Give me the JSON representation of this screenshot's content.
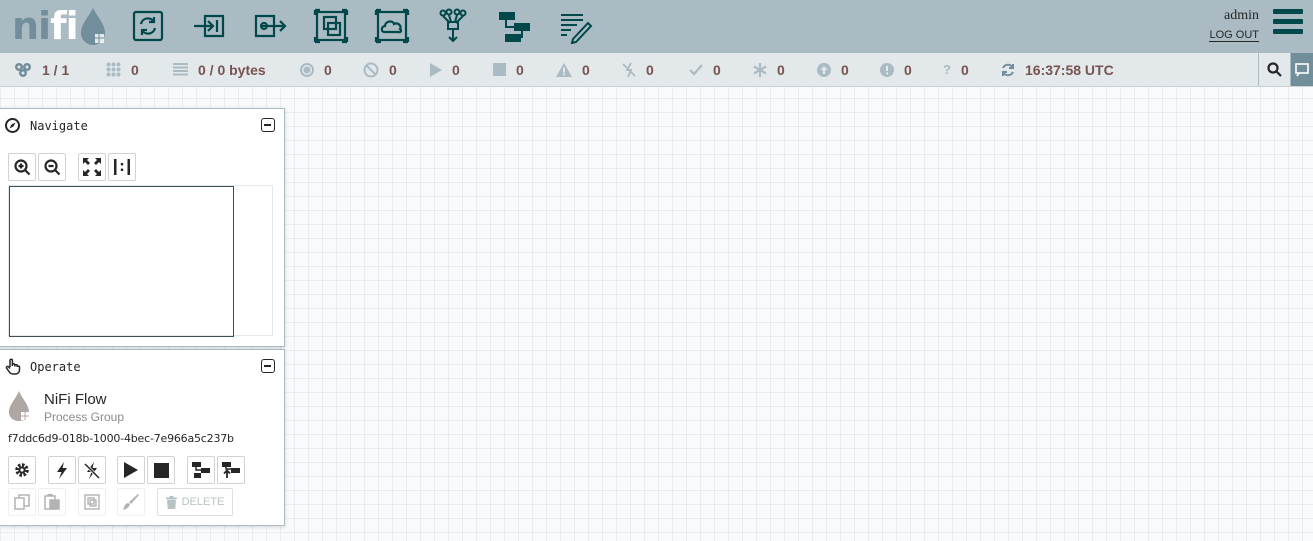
{
  "header": {
    "logo_text_1": "ni",
    "logo_text_2": "f",
    "logo_text_3": "i",
    "user": "admin",
    "logout_label": "LOG OUT"
  },
  "status": {
    "threads": "1 / 1",
    "transmitting": "0",
    "queued": "0 / 0 bytes",
    "transmitting_rpg": "0",
    "not_transmitting_rpg": "0",
    "running": "0",
    "stopped": "0",
    "invalid": "0",
    "disabled": "0",
    "up_to_date": "0",
    "locally_modified": "0",
    "stale": "0",
    "errors": "0",
    "sync_failure": "0",
    "last_refreshed": "16:37:58 UTC"
  },
  "navigate": {
    "title": "Navigate"
  },
  "operate": {
    "title": "Operate",
    "pg_name": "NiFi Flow",
    "pg_type": "Process Group",
    "pg_id": "f7ddc6d9-018b-1000-4bec-7e966a5c237b",
    "delete_label": "DELETE"
  },
  "colors": {
    "header_bg": "#aabbc3",
    "icon_dark": "#004849",
    "status_value": "#775351",
    "status_icon": "#728e9b"
  }
}
